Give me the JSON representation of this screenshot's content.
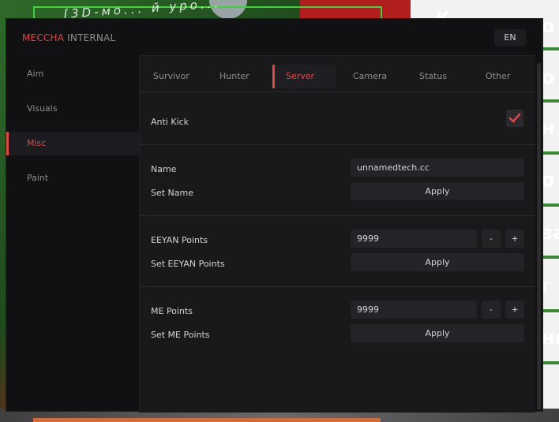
{
  "window": {
    "brand_accent": "MECCHA",
    "brand_rest": " INTERNAL",
    "language": "EN",
    "accent_color": "#e64545"
  },
  "sidebar": {
    "items": [
      {
        "label": "Aim",
        "active": false
      },
      {
        "label": "Visuals",
        "active": false
      },
      {
        "label": "Misc",
        "active": true
      },
      {
        "label": "Paint",
        "active": false
      }
    ]
  },
  "tabs": [
    {
      "label": "Survivor",
      "active": false
    },
    {
      "label": "Hunter",
      "active": false
    },
    {
      "label": "Server",
      "active": true
    },
    {
      "label": "Camera",
      "active": false
    },
    {
      "label": "Status",
      "active": false
    },
    {
      "label": "Other",
      "active": false
    }
  ],
  "server": {
    "anti_kick": {
      "label": "Anti Kick",
      "checked": true
    },
    "name": {
      "label": "Name",
      "value": "unnamedtech.cc",
      "set_label": "Set Name",
      "apply": "Apply"
    },
    "eeyan": {
      "label": "EEYAN Points",
      "value": "9999",
      "minus": "-",
      "plus": "+",
      "set_label": "Set EEYAN Points",
      "apply": "Apply"
    },
    "me": {
      "label": "ME Points",
      "value": "9999",
      "minus": "-",
      "plus": "+",
      "set_label": "Set ME Points",
      "apply": "Apply"
    }
  },
  "background": {
    "banner_text": "[3D-мо... й уро...",
    "top_char": "К",
    "side_chars": [
      "о",
      "о",
      "н",
      "о",
      "за",
      "г",
      "ни"
    ]
  }
}
